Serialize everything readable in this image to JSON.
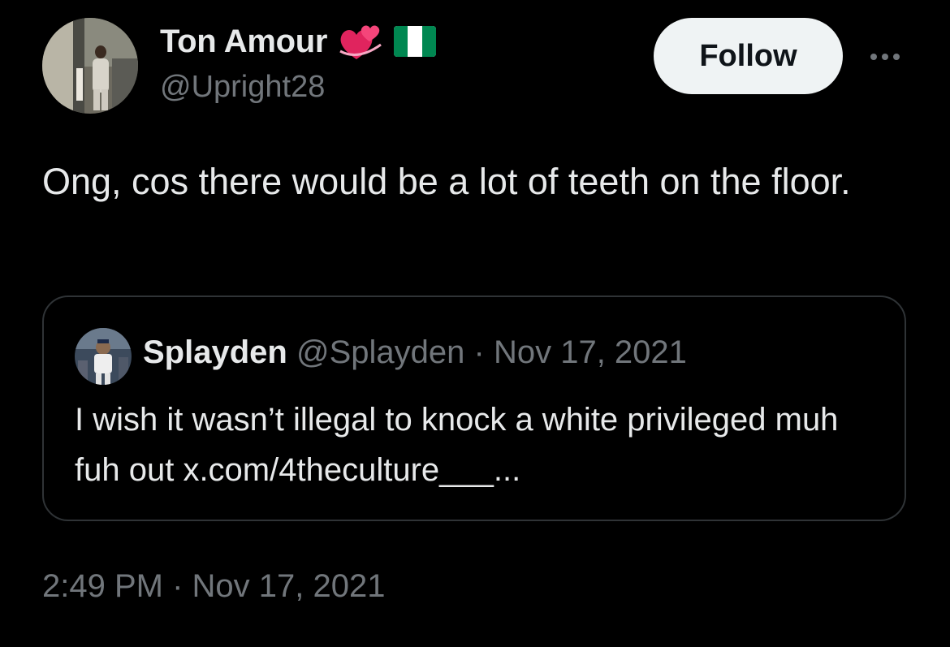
{
  "author": {
    "display_name": "Ton Amour",
    "handle": "@Upright28"
  },
  "follow_label": "Follow",
  "tweet_text": "Ong, cos there would be a lot of teeth on the floor.",
  "quoted": {
    "display_name": "Splayden",
    "handle": "@Splayden",
    "separator": "·",
    "date": "Nov 17, 2021",
    "text": "I wish it wasn’t illegal to knock a white privileged muh fuh out x.com/4theculture___..."
  },
  "timestamp": "2:49 PM · Nov 17, 2021",
  "icons": {
    "emoji_1": "two-hearts-icon",
    "emoji_2": "nigeria-flag-icon",
    "more": "more-options-icon"
  },
  "colors": {
    "background": "#000000",
    "text_primary": "#e7e9ea",
    "text_secondary": "#71767b",
    "border": "#2f3336",
    "follow_bg": "#eff3f4",
    "follow_text": "#0f1419"
  }
}
